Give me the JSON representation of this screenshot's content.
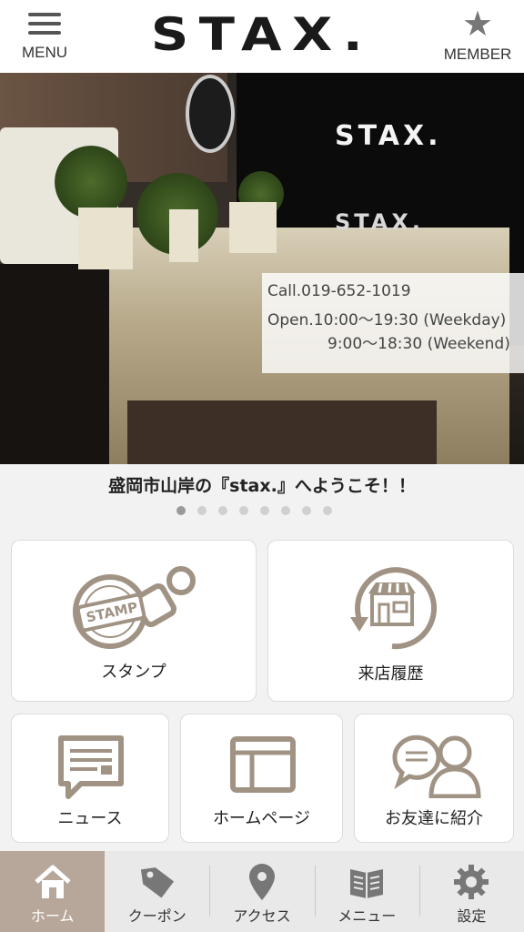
{
  "header": {
    "menu_label": "MENU",
    "logo_text": "STAX.",
    "member_label": "MEMBER"
  },
  "hero": {
    "sign_text": "STAX.",
    "sign_text_2": "STAX.",
    "call": "Call.019-652-1019",
    "open_weekday": "Open.10:00～19:30 (Weekday)",
    "open_weekend": "9:00～18:30 (Weekend)"
  },
  "welcome_text": "盛岡市山岸の『stax.』へようこそ！！",
  "carousel": {
    "total": 8,
    "active": 1
  },
  "tiles": {
    "stamp": "スタンプ",
    "stamp_icon_text": "STAMP",
    "history": "来店履歴",
    "news": "ニュース",
    "homepage": "ホームページ",
    "friend": "お友達に紹介"
  },
  "bottom_nav": {
    "home": "ホーム",
    "coupon": "クーポン",
    "access": "アクセス",
    "menu": "メニュー",
    "settings": "設定"
  },
  "colors": {
    "icon_taupe": "#a09384",
    "nav_active": "#b6a79a",
    "nav_bg": "#e9e9e9"
  }
}
